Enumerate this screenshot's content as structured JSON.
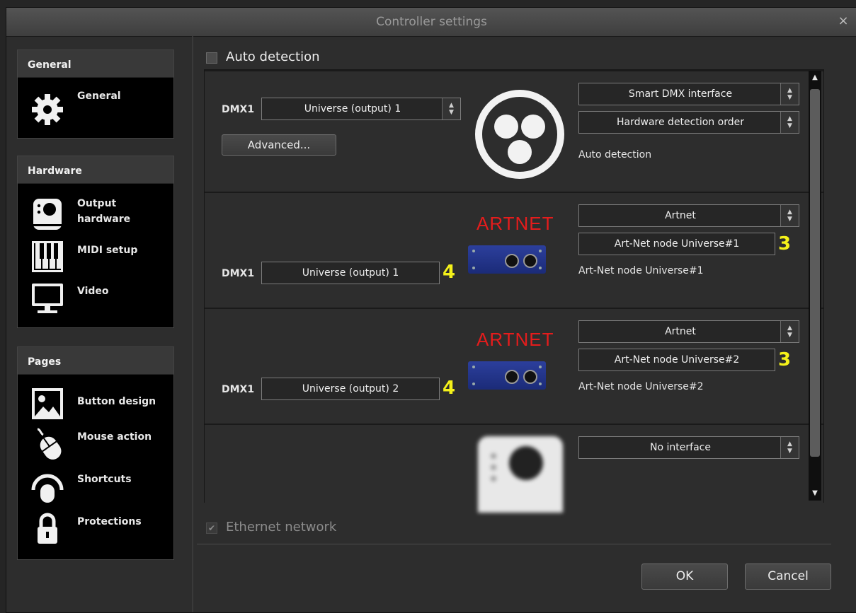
{
  "window": {
    "title": "Controller settings",
    "close_symbol": "×"
  },
  "sidebar": {
    "groups": [
      {
        "header": "General",
        "items": [
          {
            "label": "General",
            "icon": "gear-icon"
          }
        ]
      },
      {
        "header": "Hardware",
        "items": [
          {
            "label": "Output hardware",
            "icon": "output-hardware-icon"
          },
          {
            "label": "MIDI setup",
            "icon": "midi-keyboard-icon"
          },
          {
            "label": "Video",
            "icon": "monitor-icon"
          }
        ]
      },
      {
        "header": "Pages",
        "items": [
          {
            "label": "Button design",
            "icon": "image-icon"
          },
          {
            "label": "Mouse action",
            "icon": "mouse-icon"
          },
          {
            "label": "Shortcuts",
            "icon": "fingerprint-icon"
          },
          {
            "label": "Protections",
            "icon": "lock-icon"
          }
        ]
      }
    ]
  },
  "main": {
    "auto_detection": {
      "label": "Auto detection",
      "checked": false
    },
    "cards": [
      {
        "dmx_label": "DMX1",
        "universe": "Universe (output) 1",
        "advanced": "Advanced...",
        "interface": "Smart DMX interface",
        "secondary": "Hardware detection order",
        "status": "Auto detection",
        "image": "auto-detection-logo"
      },
      {
        "dmx_label": "DMX1",
        "universe": "Universe (output) 1",
        "universe_badge": "4",
        "interface": "Artnet",
        "secondary": "Art-Net node Universe#1",
        "secondary_badge": "3",
        "status": "Art-Net node Universe#1",
        "brand_text": "ARTNET",
        "image": "artnet-node-device"
      },
      {
        "dmx_label": "DMX1",
        "universe": "Universe (output) 2",
        "universe_badge": "4",
        "interface": "Artnet",
        "secondary": "Art-Net node Universe#2",
        "secondary_badge": "3",
        "status": "Art-Net node Universe#2",
        "brand_text": "ARTNET",
        "image": "artnet-node-device"
      },
      {
        "interface": "No interface",
        "image": "no-interface-device"
      }
    ],
    "ethernet": {
      "label": "Ethernet network",
      "checked": true,
      "enabled": false
    }
  },
  "footer": {
    "ok": "OK",
    "cancel": "Cancel"
  },
  "colors": {
    "accent_badge": "#f4f11a",
    "artnet_red": "#e51c1c"
  }
}
